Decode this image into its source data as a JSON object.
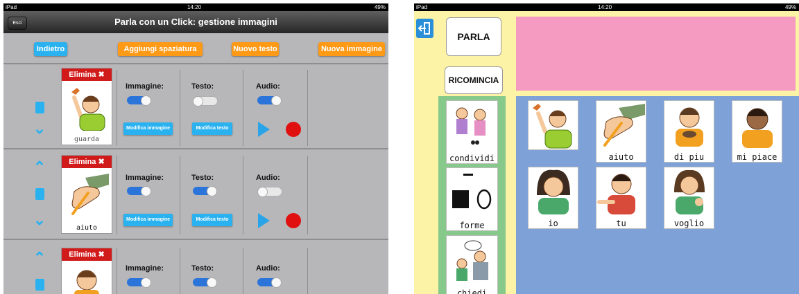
{
  "left": {
    "status": {
      "device": "iPad",
      "time": "14:20",
      "battery": "49%"
    },
    "navbar": {
      "back_label": "Esci",
      "title": "Parla con un Click: gestione immagini"
    },
    "toolbar": {
      "back": "Indietro",
      "add_spacing": "Aggiungi spaziatura",
      "new_text": "Nuovo testo",
      "new_image": "Nuova immagine"
    },
    "rows": [
      {
        "delete": "Elimina",
        "caption": "guarda",
        "image_label": "Immagine:",
        "text_label": "Testo:",
        "audio_label": "Audio:",
        "image_on": true,
        "text_on": false,
        "audio_on": true,
        "edit_image": "Modifica immagine",
        "edit_text": "Modifica testo"
      },
      {
        "delete": "Elimina",
        "caption": "aiuto",
        "image_label": "Immagine:",
        "text_label": "Testo:",
        "audio_label": "Audio:",
        "image_on": true,
        "text_on": true,
        "audio_on": false,
        "edit_image": "Modifica immagine",
        "edit_text": "Modifica testo"
      },
      {
        "delete": "Elimina",
        "caption": "",
        "image_label": "Immagine:",
        "text_label": "Testo:",
        "audio_label": "Audio:",
        "image_on": true,
        "text_on": true,
        "audio_on": true
      }
    ]
  },
  "right": {
    "status": {
      "device": "iPad",
      "time": "14:20",
      "battery": "49%"
    },
    "speak": "PARLA",
    "restart": "RICOMINCIA",
    "categories": [
      "condividi",
      "forme",
      "chiedi"
    ],
    "tiles": [
      "aiuto",
      "di piu",
      "mi piace",
      "io",
      "tu",
      "voglio"
    ],
    "colors": {
      "sentence_bar": "#f59ac0",
      "grid_bg": "#7ea2d8",
      "category_bg": "#86c98a",
      "frame": "#fdf3a6"
    }
  }
}
